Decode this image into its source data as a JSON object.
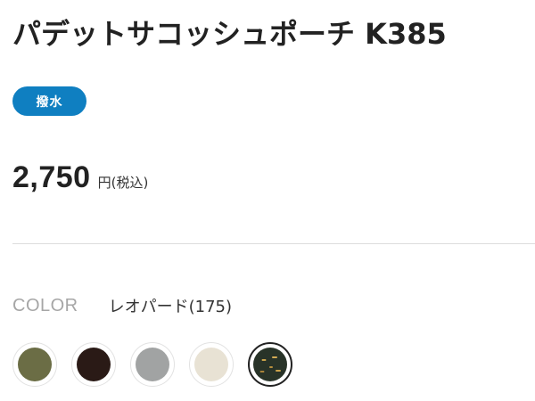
{
  "product": {
    "title": "パデットサコッシュポーチ K385",
    "badge": "撥水",
    "price": "2,750",
    "price_unit": "円(税込)"
  },
  "color": {
    "label": "COLOR",
    "selected_name": "レオパード(175)",
    "swatches": [
      {
        "name": "olive",
        "color": "#6b6d45"
      },
      {
        "name": "dark-brown",
        "color": "#2a1a16"
      },
      {
        "name": "gray",
        "color": "#a1a3a3"
      },
      {
        "name": "ivory",
        "color": "#e8e2d4"
      },
      {
        "name": "leopard",
        "color": "#283328",
        "selected": true
      }
    ]
  }
}
